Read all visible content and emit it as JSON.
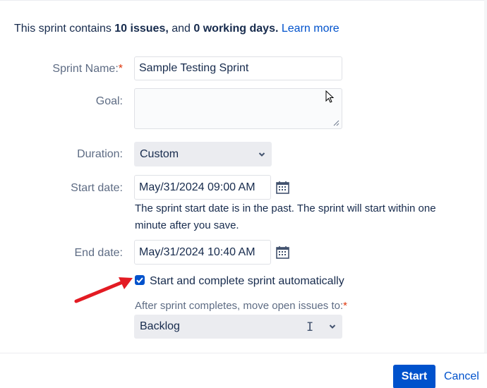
{
  "intro": {
    "prefix": "This sprint contains ",
    "issues": "10 issues,",
    "middle": " and ",
    "days": "0 working days.",
    "link": "Learn more"
  },
  "form": {
    "sprint_name_label": "Sprint Name:",
    "required_mark": "*",
    "sprint_name_value": "Sample Testing Sprint",
    "goal_label": "Goal:",
    "goal_value": "",
    "duration_label": "Duration:",
    "duration_value": "Custom",
    "start_label": "Start date:",
    "start_value": "May/31/2024 09:00 AM",
    "start_helper": "The sprint start date is in the past. The sprint will start within one minute after you save.",
    "end_label": "End date:",
    "end_value": "May/31/2024 10:40 AM",
    "auto_checkbox_label": "Start and complete sprint automatically",
    "auto_checkbox_checked": true,
    "after_label": "After sprint completes, move open issues to:",
    "after_value": "Backlog"
  },
  "footer": {
    "start_button": "Start",
    "cancel_button": "Cancel"
  },
  "colors": {
    "accent": "#0052cc",
    "required": "#de350b",
    "annotation_arrow": "#e31b23"
  },
  "icons": [
    "calendar-icon",
    "chevron-down-icon",
    "checkmark-icon",
    "mouse-pointer-icon",
    "text-cursor-icon"
  ]
}
